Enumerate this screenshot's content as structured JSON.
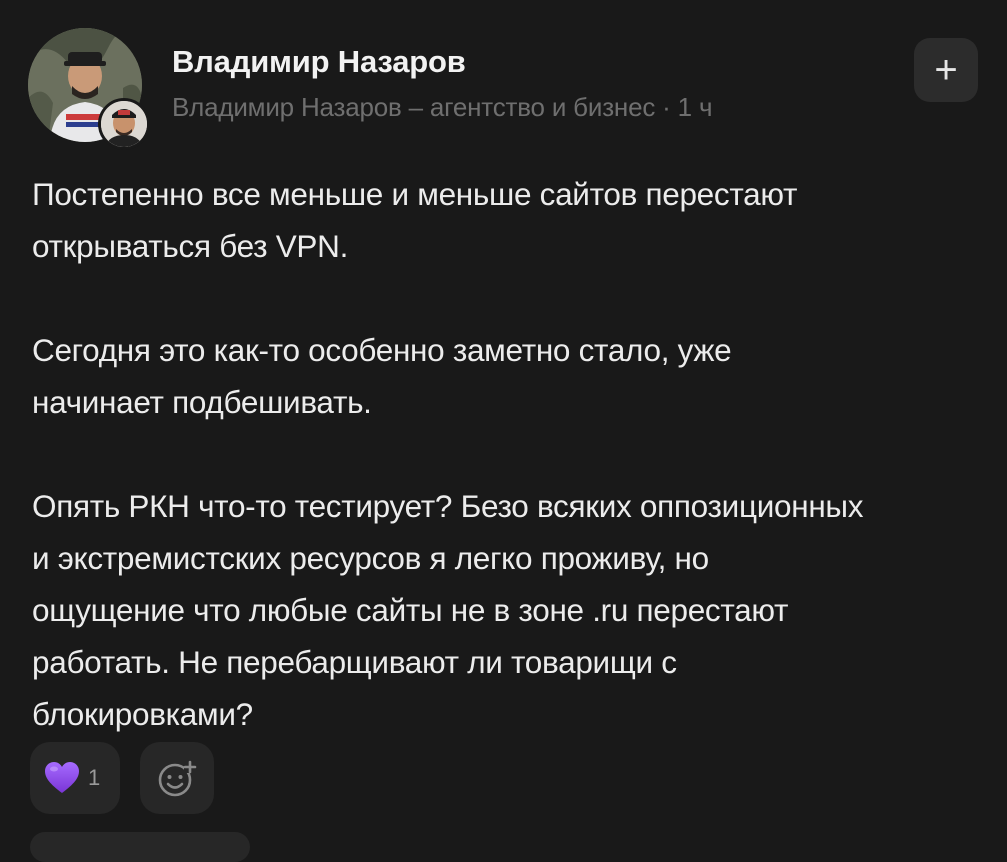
{
  "post": {
    "author_name": "Владимир Назаров",
    "channel": "Владимир Назаров – агентство и бизнес",
    "separator": " · ",
    "time": "1 ч",
    "follow_label": "+",
    "paragraphs": [
      "Постепенно все меньше и меньше сайтов перестают\nоткрываться без VPN.",
      "Сегодня это как-то особенно заметно стало, уже\nначинает подбешивать.",
      "Опять РКН что-то тестирует? Безо всяких оппозиционных\nи экстремистских ресурсов я легко проживу, но\nощущение что любые сайты не в зоне .ru перестают\nработать. Не перебарщивают ли товарищи с\nблокировками?"
    ]
  },
  "reactions": {
    "items": [
      {
        "icon": "purple-heart-icon",
        "count": "1",
        "color": "#8e4fe8"
      }
    ],
    "add_icon": "add-reaction-icon"
  },
  "colors": {
    "background": "#191919",
    "chip": "#272727",
    "text": "#ececec",
    "muted": "#6f6f6f"
  }
}
